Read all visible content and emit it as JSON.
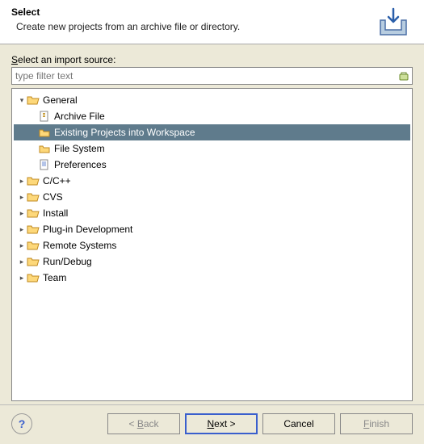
{
  "header": {
    "title": "Select",
    "description": "Create new projects from an archive file or directory."
  },
  "label": {
    "pre": "S",
    "rest": "elect an import source:"
  },
  "filter": {
    "placeholder": "type filter text"
  },
  "tree": {
    "general": {
      "label": "General",
      "expanded": true
    },
    "leaves": {
      "archive": "Archive File",
      "existing": "Existing Projects into Workspace",
      "filesystem": "File System",
      "preferences": "Preferences"
    },
    "folders": {
      "cpp": "C/C++",
      "cvs": "CVS",
      "install": "Install",
      "plugin": "Plug-in Development",
      "remote": "Remote Systems",
      "rundebug": "Run/Debug",
      "team": "Team"
    }
  },
  "buttons": {
    "back": {
      "pre": "< ",
      "ul": "B",
      "post": "ack"
    },
    "next": {
      "pre": "",
      "ul": "N",
      "post": "ext >"
    },
    "cancel": "Cancel",
    "finish": {
      "pre": "",
      "ul": "F",
      "post": "inish"
    }
  }
}
